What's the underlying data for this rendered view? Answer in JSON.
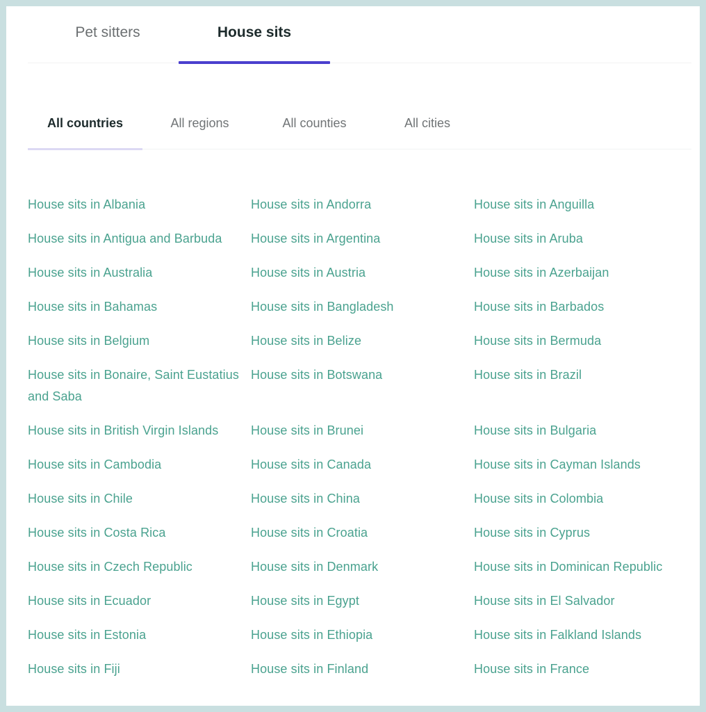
{
  "top_tabs": [
    {
      "label": "Pet sitters",
      "active": false
    },
    {
      "label": "House sits",
      "active": true
    }
  ],
  "sub_tabs": [
    {
      "label": "All countries",
      "active": true
    },
    {
      "label": "All regions",
      "active": false
    },
    {
      "label": "All counties",
      "active": false
    },
    {
      "label": "All cities",
      "active": false
    }
  ],
  "colors": {
    "background": "#c9dfe0",
    "link": "#4aa28f",
    "active_tab_underline": "#4b3fce",
    "active_subtab_underline": "#dcd9f4",
    "active_text": "#1d2b2c"
  },
  "links": [
    "House sits in Albania",
    "House sits in Andorra",
    "House sits in Anguilla",
    "House sits in Antigua and Barbuda",
    "House sits in Argentina",
    "House sits in Aruba",
    "House sits in Australia",
    "House sits in Austria",
    "House sits in Azerbaijan",
    "House sits in Bahamas",
    "House sits in Bangladesh",
    "House sits in Barbados",
    "House sits in Belgium",
    "House sits in Belize",
    "House sits in Bermuda",
    "House sits in Bonaire, Saint Eustatius and Saba",
    "House sits in Botswana",
    "House sits in Brazil",
    "House sits in British Virgin Islands",
    "House sits in Brunei",
    "House sits in Bulgaria",
    "House sits in Cambodia",
    "House sits in Canada",
    "House sits in Cayman Islands",
    "House sits in Chile",
    "House sits in China",
    "House sits in Colombia",
    "House sits in Costa Rica",
    "House sits in Croatia",
    "House sits in Cyprus",
    "House sits in Czech Republic",
    "House sits in Denmark",
    "House sits in Dominican Republic",
    "House sits in Ecuador",
    "House sits in Egypt",
    "House sits in El Salvador",
    "House sits in Estonia",
    "House sits in Ethiopia",
    "House sits in Falkland Islands",
    "House sits in Fiji",
    "House sits in Finland",
    "House sits in France"
  ]
}
